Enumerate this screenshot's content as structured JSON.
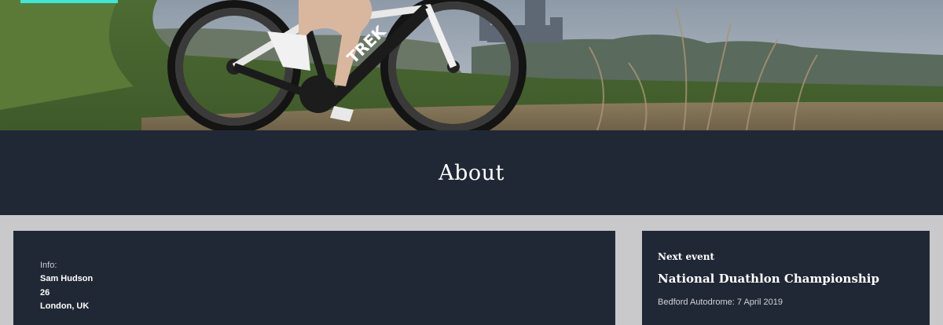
{
  "hero": {
    "image_alt": "Cyclist riding a TREK time-trial bike along a grassy path with a cathedral on the horizon",
    "bike_brand_text": "TREK",
    "accent_color": "#3ee6d8"
  },
  "about": {
    "title": "About"
  },
  "info": {
    "label": "Info:",
    "name": "Sam Hudson",
    "age": "26",
    "location": "London, UK"
  },
  "next_event": {
    "kicker": "Next event",
    "name": "National Duathlon Championship",
    "details": "Bedford Autodrome: 7 April 2019"
  },
  "colors": {
    "panel": "#212835",
    "page_background": "#c9c9cb"
  }
}
